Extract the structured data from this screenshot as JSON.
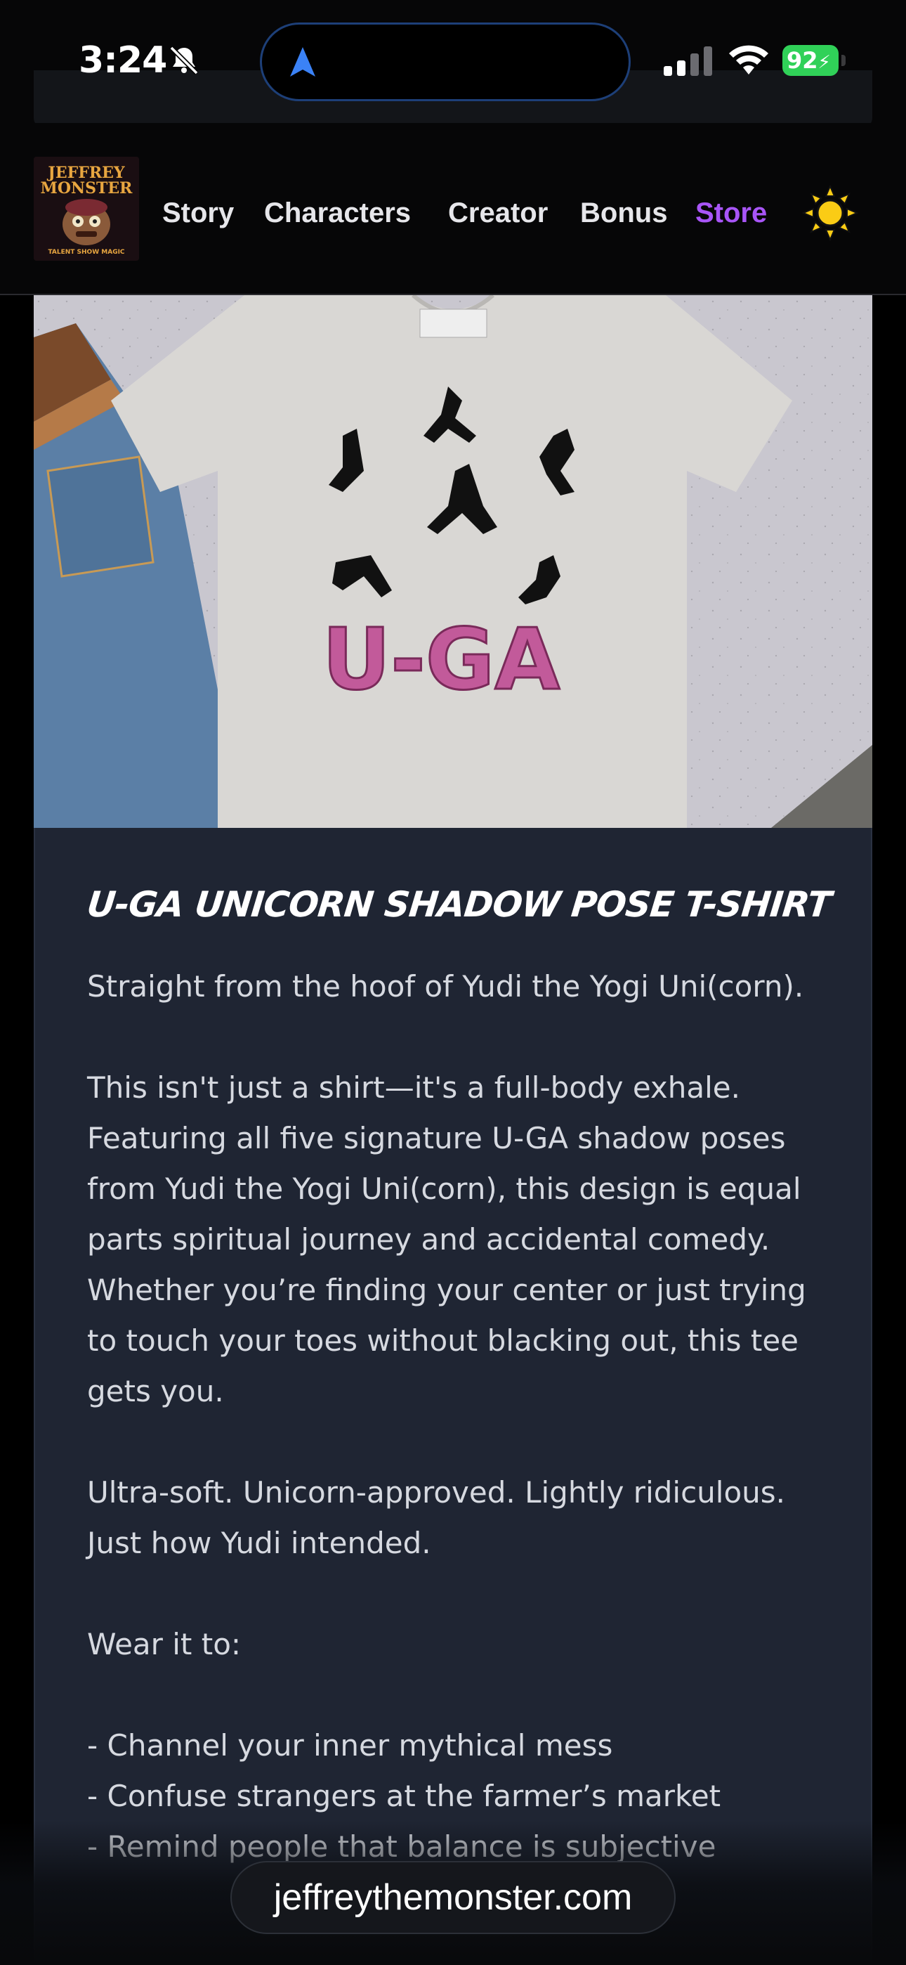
{
  "status_bar": {
    "time": "3:24",
    "battery": "92"
  },
  "site": {
    "logo_text": [
      "JEFFREY",
      "MONSTER",
      "TALENT SHOW MAGIC"
    ],
    "nav": [
      {
        "label": "Story"
      },
      {
        "label": "Characters"
      },
      {
        "label": "Creator"
      },
      {
        "label": "Bonus"
      },
      {
        "label": "Store",
        "active": true
      }
    ],
    "accent_color": "#a855f7",
    "theme_icon": "sun-icon"
  },
  "product": {
    "image_text": "U-GA",
    "title": "U-GA UNICORN SHADOW POSE T-SHIRT",
    "description": "Straight from the hoof of Yudi the Yogi Uni(corn).\n\nThis isn't just a shirt—it's a full-body exhale. Featuring all five signature U-GA shadow poses from Yudi the Yogi Uni(corn), this design is equal parts spiritual journey and accidental comedy. Whether you’re finding your center or just trying to touch your toes without blacking out, this tee gets you.\n\nUltra-soft. Unicorn-approved. Lightly ridiculous. Just how Yudi intended.\n\nWear it to:\n\n- Channel your inner mythical mess\n- Confuse strangers at the farmer’s market\n- Remind people that balance is subjective"
  },
  "browser": {
    "url": "jeffreythemonster.com"
  }
}
